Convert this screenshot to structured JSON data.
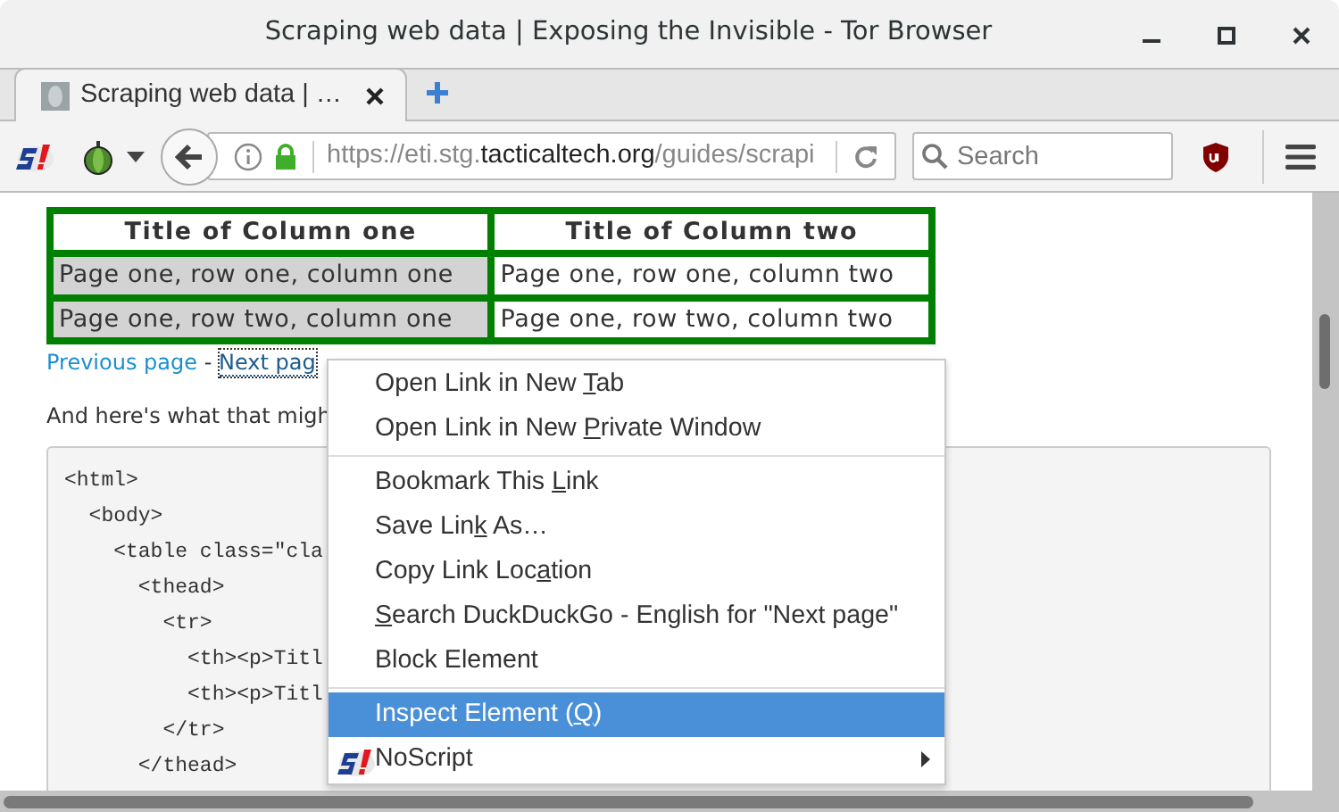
{
  "window": {
    "title": "Scraping web data | Exposing the Invisible - Tor Browser"
  },
  "tabs": [
    {
      "label": "Scraping web data | …",
      "selected": true
    }
  ],
  "toolbar": {
    "url": {
      "prefix": "https://eti.stg.",
      "domain": "tacticaltech.org",
      "suffix": "/guides/scrapi"
    },
    "search": {
      "placeholder": "Search"
    }
  },
  "page": {
    "table": {
      "columns": [
        "Title of Column one",
        "Title of Column two"
      ],
      "rows": [
        [
          "Page one, row one, column one",
          "Page one, row one, column two"
        ],
        [
          "Page one, row two, column one",
          "Page one, row two, column two"
        ]
      ]
    },
    "pager": {
      "previous": "Previous page",
      "separator": "-",
      "next": "Next pag"
    },
    "paragraph": "And here's what that migh",
    "code_lines": [
      "<html>",
      "  <body>",
      "    <table class=\"cla",
      "      <thead>",
      "        <tr>",
      "          <th><p>Titl",
      "          <th><p>Titl",
      "        </tr>",
      "      </thead>"
    ]
  },
  "context_menu": {
    "groups": [
      [
        {
          "before": "Open Link in New ",
          "key": "T",
          "after": "ab",
          "selected": false
        },
        {
          "before": "Open Link in New ",
          "key": "P",
          "after": "rivate Window",
          "selected": false
        }
      ],
      [
        {
          "before": "Bookmark This ",
          "key": "L",
          "after": "ink",
          "selected": false
        },
        {
          "before": "Save Lin",
          "key": "k",
          "after": " As…",
          "selected": false
        },
        {
          "before": "Copy Link Loc",
          "key": "a",
          "after": "tion",
          "selected": false
        },
        {
          "key": "S",
          "after": "earch DuckDuckGo - English for \"Next page\"",
          "selected": false
        },
        {
          "before": "Block Element",
          "selected": false
        }
      ],
      [
        {
          "before": "Inspect Element (",
          "key": "Q",
          "after": ")",
          "selected": true
        },
        {
          "before": "NoScript",
          "selected": false,
          "kind": "submenu"
        }
      ]
    ]
  }
}
